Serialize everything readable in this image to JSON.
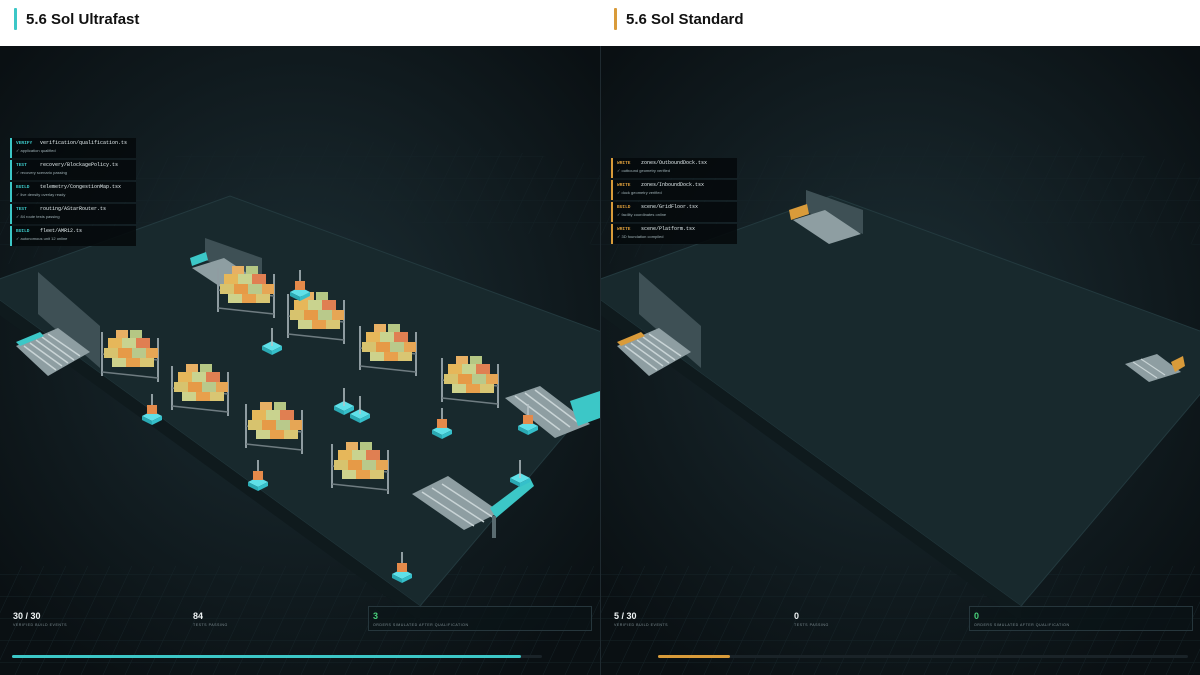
{
  "colors": {
    "accent_left": "#3cc7c7",
    "accent_right": "#d99b3a",
    "pass_green": "#49d07a"
  },
  "panels": {
    "left": {
      "title": "5.6 Sol Ultrafast",
      "log": [
        {
          "kind": "VERIFY",
          "file": "verification/qualification.ts",
          "status": "✓ application qualified"
        },
        {
          "kind": "TEST",
          "file": "recovery/BlockagePolicy.ts",
          "status": "✓ recovery scenario passing"
        },
        {
          "kind": "BUILD",
          "file": "telemetry/CongestionMap.tsx",
          "status": "✓ live density overlay ready"
        },
        {
          "kind": "TEST",
          "file": "routing/AStarRouter.ts",
          "status": "✓ 84 route tests passing"
        },
        {
          "kind": "BUILD",
          "file": "fleet/AMR12.ts",
          "status": "✓ autonomous unit 12 online"
        }
      ],
      "stats": [
        {
          "value": "30 / 30",
          "label": "VERIFIED BUILD EVENTS"
        },
        {
          "value": "84",
          "label": "TESTS PASSING"
        },
        {
          "value": "3",
          "label": "ORDERS SIMULATED AFTER QUALIFICATION"
        }
      ],
      "progress": 0.96
    },
    "right": {
      "title": "5.6 Sol Standard",
      "log": [
        {
          "kind": "WRITE",
          "file": "zones/OutboundDock.tsx",
          "status": "✓ outbound geometry verified"
        },
        {
          "kind": "WRITE",
          "file": "zones/InboundDock.tsx",
          "status": "✓ dock geometry verified"
        },
        {
          "kind": "BUILD",
          "file": "scene/GridFloor.tsx",
          "status": "✓ facility coordinates online"
        },
        {
          "kind": "WRITE",
          "file": "scene/Platform.tsx",
          "status": "✓ 3D foundation compiled"
        }
      ],
      "stats": [
        {
          "value": "5 / 30",
          "label": "VERIFIED BUILD EVENTS"
        },
        {
          "value": "0",
          "label": "TESTS PASSING"
        },
        {
          "value": "0",
          "label": "ORDERS SIMULATED AFTER QUALIFICATION"
        }
      ],
      "progress": 0.135
    }
  }
}
